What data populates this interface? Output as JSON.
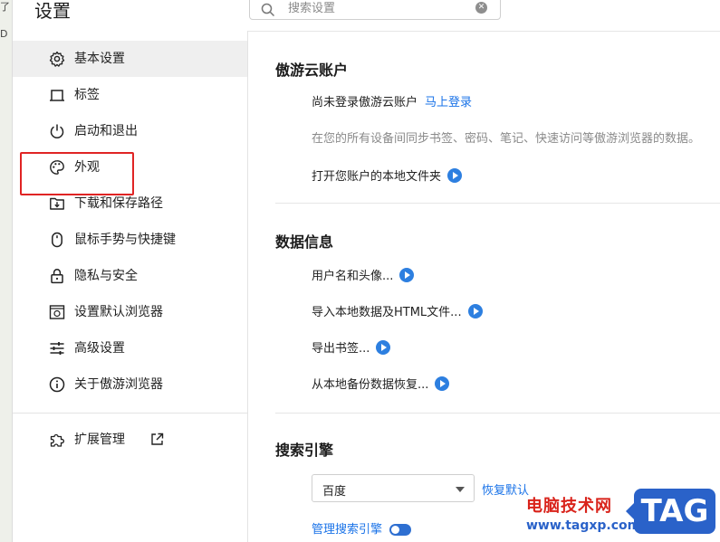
{
  "window": {
    "title": "设置"
  },
  "left_strip": {
    "glyph_top": "了",
    "glyph_bottom": "D"
  },
  "search": {
    "placeholder": "搜索设置"
  },
  "sidebar": {
    "items": [
      {
        "label": "基本设置",
        "icon": "gear-icon",
        "active": true
      },
      {
        "label": "标签",
        "icon": "tab-icon"
      },
      {
        "label": "启动和退出",
        "icon": "power-icon"
      },
      {
        "label": "外观",
        "icon": "palette-icon"
      },
      {
        "label": "下载和保存路径",
        "icon": "download-folder-icon"
      },
      {
        "label": "鼠标手势与快捷键",
        "icon": "mouse-icon"
      },
      {
        "label": "隐私与安全",
        "icon": "lock-icon"
      },
      {
        "label": "设置默认浏览器",
        "icon": "browser-window-icon"
      },
      {
        "label": "高级设置",
        "icon": "sliders-icon"
      },
      {
        "label": "关于傲游浏览器",
        "icon": "info-icon"
      }
    ],
    "extensions": {
      "label": "扩展管理",
      "icon": "puzzle-icon",
      "external_icon": "external-link-icon"
    }
  },
  "account": {
    "title": "傲游云账户",
    "status": "尚未登录傲游云账户",
    "login_link": "马上登录",
    "description": "在您的所有设备间同步书签、密码、笔记、快速访问等傲游浏览器的数据。",
    "open_folder": "打开您账户的本地文件夹"
  },
  "data_info": {
    "title": "数据信息",
    "items": [
      "用户名和头像...",
      "导入本地数据及HTML文件...",
      "导出书签...",
      "从本地备份数据恢复..."
    ]
  },
  "search_engine": {
    "title": "搜索引擎",
    "selected": "百度",
    "restore_default": "恢复默认",
    "manage": "管理搜索引擎"
  },
  "watermark": {
    "text": "电脑技术网",
    "url": "www.tagxp.com",
    "badge": "TAG"
  },
  "colors": {
    "accent": "#1a73e8",
    "highlight": "#e02424",
    "active_bg": "#efefef",
    "badge": "#2a62c9"
  }
}
